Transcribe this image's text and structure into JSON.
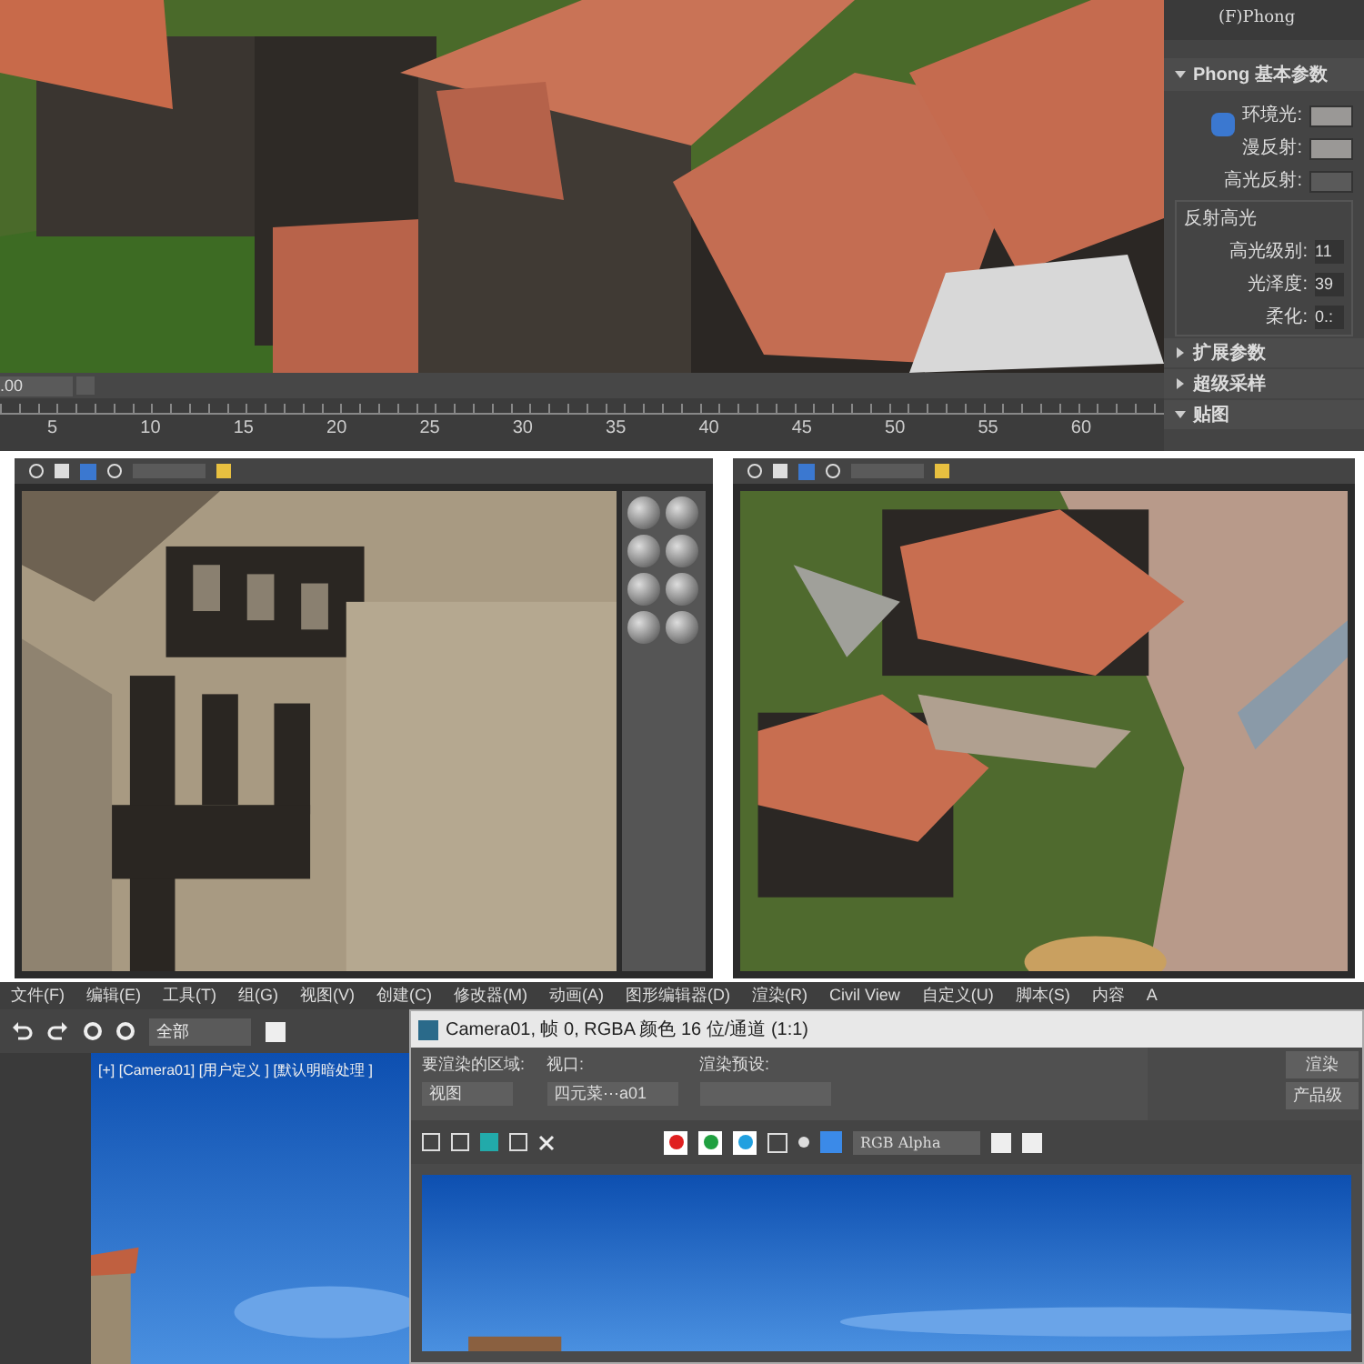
{
  "top_view": {
    "timeline": {
      "frame_field": ".00",
      "ticks": [
        "5",
        "10",
        "15",
        "20",
        "25",
        "30",
        "35",
        "40",
        "45",
        "50",
        "55",
        "60"
      ]
    },
    "material_panel": {
      "shader": "(F)Phong",
      "rollouts": [
        {
          "title": "Phong 基本参数",
          "expanded": true
        },
        {
          "title": "扩展参数",
          "expanded": false
        },
        {
          "title": "超级采样",
          "expanded": false
        },
        {
          "title": "贴图",
          "expanded": true
        }
      ],
      "colors": [
        {
          "label": "环境光:",
          "color": "#9a9896"
        },
        {
          "label": "漫反射:",
          "color": "#9a9896"
        },
        {
          "label": "高光反射:",
          "color": "#5a5a5a"
        }
      ],
      "highlight_group": "反射高光",
      "highlight_fields": [
        {
          "label": "高光级别:",
          "value": "11"
        },
        {
          "label": "光泽度:",
          "value": "39"
        },
        {
          "label": "柔化:",
          "value": "0.:"
        }
      ]
    }
  },
  "bottom": {
    "menu": [
      "文件(F)",
      "编辑(E)",
      "工具(T)",
      "组(G)",
      "视图(V)",
      "创建(C)",
      "修改器(M)",
      "动画(A)",
      "图形编辑器(D)",
      "渲染(R)",
      "Civil View",
      "自定义(U)",
      "脚本(S)",
      "内容",
      "A"
    ],
    "selection_filter": "全部",
    "viewport_label": "[+] [Camera01] [用户定义 ] [默认明暗处理 ]",
    "render_window": {
      "title": "Camera01, 帧 0, RGBA 颜色 16 位/通道 (1:1)",
      "area_label": "要渲染的区域:",
      "area_value": "视图",
      "viewport_label": "视口:",
      "viewport_value": "四元菜⋯a01",
      "preset_label": "渲染预设:",
      "render_button": "渲染",
      "quality": "产品级",
      "channels": [
        {
          "color": "#e02020",
          "selected": true
        },
        {
          "color": "#20a040",
          "selected": true
        },
        {
          "color": "#20a0e0",
          "selected": true
        }
      ],
      "display": "RGB Alpha"
    }
  }
}
